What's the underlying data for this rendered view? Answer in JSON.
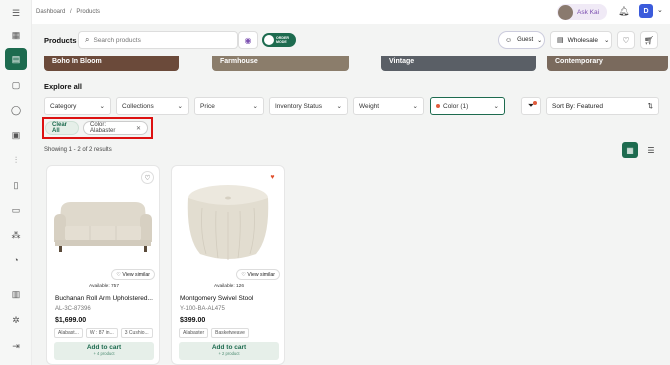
{
  "breadcrumb": [
    "Dashboard",
    "/",
    "Products"
  ],
  "header": {
    "ask_label": "Ask Kai",
    "user_initial": "D"
  },
  "toolbar": {
    "title": "Products",
    "search_placeholder": "Search products",
    "order_mode_label": "ORDER MODE",
    "guest_label": "Guest",
    "price_level": "Wholesale"
  },
  "banners": [
    {
      "label": "Boho In Bloom",
      "color": "#6b4a3a"
    },
    {
      "label": "Farmhouse",
      "color": "#8b7d6b"
    },
    {
      "label": "Vintage",
      "color": "#5a5f66"
    },
    {
      "label": "Contemporary",
      "color": "#7a6a5d"
    }
  ],
  "explore": {
    "title": "Explore all",
    "filters": [
      "Category",
      "Collections",
      "Price",
      "Inventory Status",
      "Weight",
      "Color (1)"
    ],
    "sort_label": "Sort By: Featured"
  },
  "chips": {
    "clear": "Clear All",
    "color": "Color: Alabaster"
  },
  "results_text": "Showing 1 - 2 of 2 results",
  "products": [
    {
      "name": "Buchanan Roll Arm Upholstered...",
      "sku": "AL-3C-87396",
      "price": "$1,699.00",
      "availability": "Available: 757",
      "tags": [
        "Alabast...",
        "W : 87 in...",
        "3 Cushio..."
      ],
      "view_similar": "View similar",
      "cart": "Add to cart",
      "cart_sub": "+ 4 product",
      "favorited": false
    },
    {
      "name": "Montgomery Swivel Stool",
      "sku": "Y-100-BA-AL475",
      "price": "$399.00",
      "availability": "Available: 126",
      "tags": [
        "Alabaster",
        "Basketweave"
      ],
      "view_similar": "View similar",
      "cart": "Add to cart",
      "cart_sub": "+ 2 product",
      "favorited": true
    }
  ],
  "colors": {
    "brand": "#1d6b4f",
    "accent_purple": "#7b4fb0",
    "highlight": "#dd1111",
    "favorite": "#e0502e"
  }
}
